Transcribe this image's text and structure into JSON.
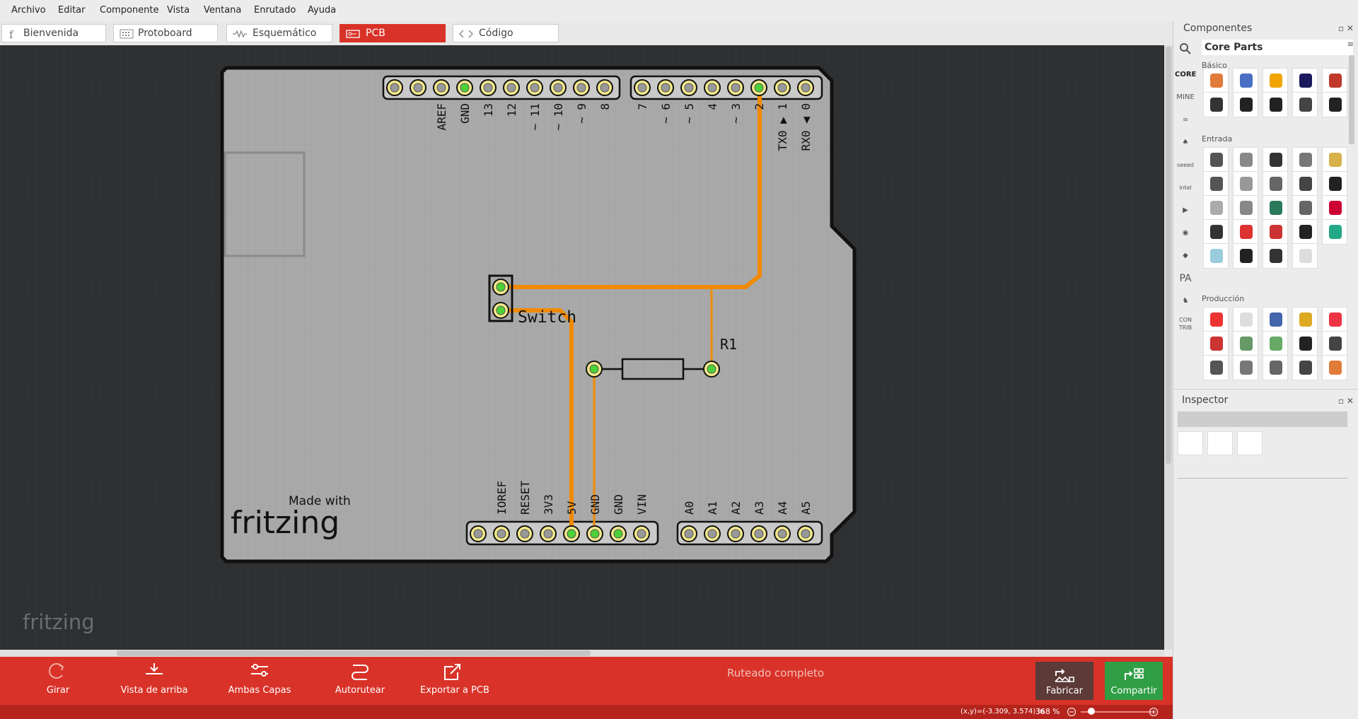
{
  "menu": [
    "Archivo",
    "Editar",
    "Componente",
    "Vista",
    "Ventana",
    "Enrutado",
    "Ayuda"
  ],
  "tabs": [
    "Bienvenida",
    "Protoboard",
    "Esquemático",
    "PCB",
    "Código"
  ],
  "active_tab": "PCB",
  "board": {
    "top_labels": [
      "AREF",
      "GND",
      "13",
      "12",
      "~ 11",
      "~ 10",
      "~ 9",
      "8",
      "7",
      "~ 6",
      "~ 5",
      "4",
      "~ 3",
      "2",
      "TX0 ▶ 1",
      "RX0 ◀ 0"
    ],
    "bottom_labels": [
      "IOREF",
      "RESET",
      "3V3",
      "5V",
      "GND",
      "GND",
      "VIN",
      "A0",
      "A1",
      "A2",
      "A3",
      "A4",
      "A5"
    ],
    "switch_label": "Switch",
    "resistor_label": "R1",
    "made_with": "Made with",
    "brand": "fritzing"
  },
  "canvas_watermark": "fritzing",
  "toolbar": {
    "rotate": "Girar",
    "top_view": "Vista de arriba",
    "both_layers": "Ambas Capas",
    "autoroute": "Autorutear",
    "export": "Exportar a PCB",
    "status": "Ruteado completo",
    "fabricate": "Fabricar",
    "share": "Compartir"
  },
  "statusbar": {
    "coords": "(x,y)=(-3.309, 3.574) in",
    "zoom": "368",
    "zoom_unit": "%"
  },
  "components_panel": {
    "title": "Componentes",
    "bin": "Core Parts",
    "sections": [
      "Básico",
      "Entrada",
      "Producción"
    ],
    "sidebar": [
      "CORE",
      "MINE",
      "seeed",
      "intel",
      "PA",
      "CON TRIB"
    ]
  },
  "inspector": {
    "title": "Inspector"
  },
  "colors": {
    "accent": "#d93228",
    "trace": "#f28a00",
    "board": "#a9a9a9",
    "canvas": "#2e2f31",
    "share": "#2f9e44"
  }
}
